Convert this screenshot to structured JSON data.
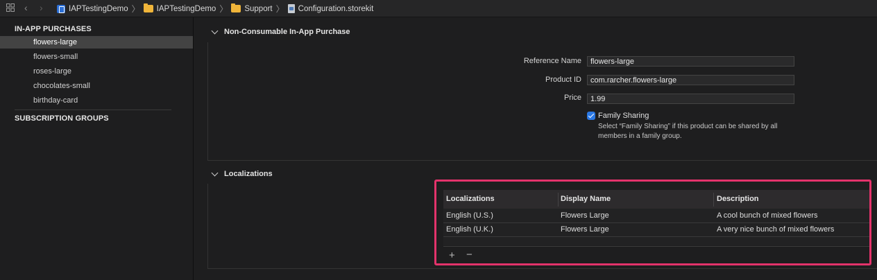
{
  "breadcrumb": {
    "items": [
      {
        "label": "IAPTestingDemo",
        "icon": "app-project-icon"
      },
      {
        "label": "IAPTestingDemo",
        "icon": "folder-icon"
      },
      {
        "label": "Support",
        "icon": "folder-icon"
      },
      {
        "label": "Configuration.storekit",
        "icon": "storekit-file-icon"
      }
    ]
  },
  "sidebar": {
    "section_iap": "IN-APP PURCHASES",
    "items": [
      "flowers-large",
      "flowers-small",
      "roses-large",
      "chocolates-small",
      "birthday-card"
    ],
    "selected": "flowers-large",
    "section_subscriptions": "SUBSCRIPTION GROUPS"
  },
  "product": {
    "section_title": "Non-Consumable In-App Purchase",
    "reference_name_label": "Reference Name",
    "reference_name_value": "flowers-large",
    "product_id_label": "Product ID",
    "product_id_value": "com.rarcher.flowers-large",
    "price_label": "Price",
    "price_value": "1.99",
    "family_sharing_label": "Family Sharing",
    "family_sharing_checked": true,
    "family_sharing_help_line1": "Select “Family Sharing” if this product can be shared by all",
    "family_sharing_help_line2": "members in a family group."
  },
  "localizations": {
    "section_title": "Localizations",
    "columns": [
      "Localizations",
      "Display Name",
      "Description"
    ],
    "rows": [
      [
        "English (U.S.)",
        "Flowers Large",
        "A cool bunch of mixed flowers"
      ],
      [
        "English (U.K.)",
        "Flowers Large",
        "A very nice bunch of mixed flowers"
      ]
    ],
    "add_label": "+",
    "remove_label": "−"
  },
  "colors": {
    "highlight": "#e3336b",
    "checkbox": "#2a78e4",
    "selection": "#434343"
  }
}
